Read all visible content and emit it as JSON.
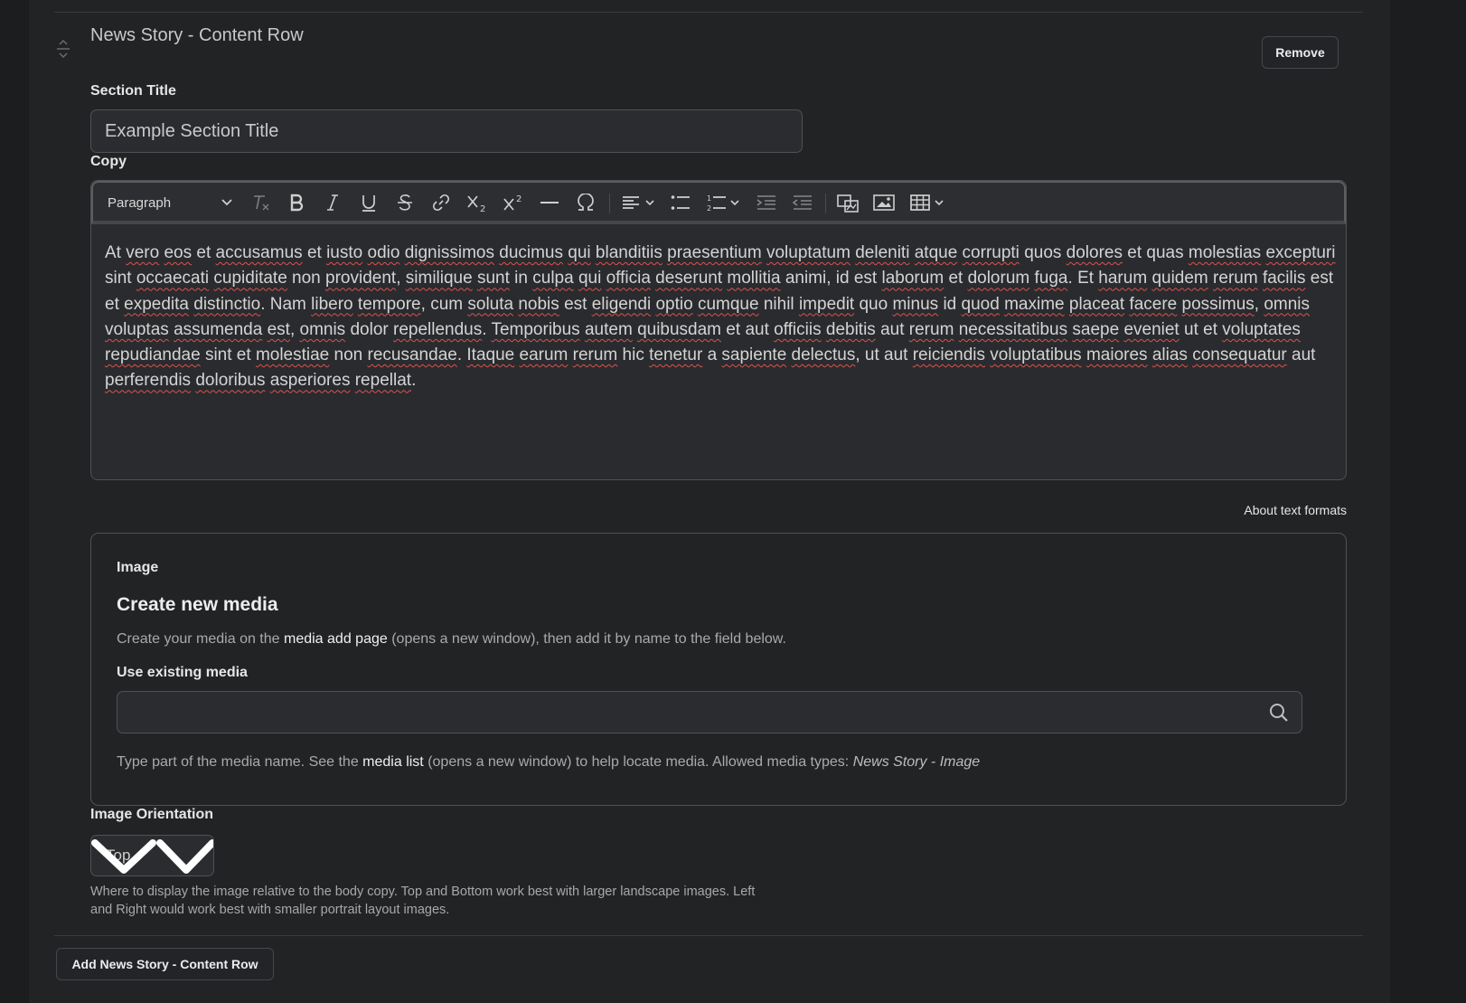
{
  "content_row": {
    "title": "News Story - Content Row",
    "remove_label": "Remove"
  },
  "section_title": {
    "label": "Section Title",
    "value": "Example Section Title"
  },
  "copy": {
    "label": "Copy",
    "toolbar": {
      "format": "Paragraph",
      "icons": [
        "remove-format-icon",
        "bold-icon",
        "italic-icon",
        "underline-icon",
        "strikethrough-icon",
        "link-icon",
        "subscript-icon",
        "superscript-icon",
        "horizontal-line-icon",
        "special-characters-icon",
        "align-icon",
        "bulleted-list-icon",
        "numbered-list-icon",
        "indent-icon",
        "outdent-icon",
        "insert-media-icon",
        "insert-image-icon",
        "insert-table-icon"
      ]
    },
    "body_text": "At vero eos et accusamus et iusto odio dignissimos ducimus qui blanditiis praesentium voluptatum deleniti atque corrupti quos dolores et quas molestias excepturi sint occaecati cupiditate non provident, similique sunt in culpa qui officia deserunt mollitia animi, id est laborum et dolorum fuga. Et harum quidem rerum facilis est et expedita distinctio. Nam libero tempore, cum soluta nobis est eligendi optio cumque nihil impedit quo minus id quod maxime placeat facere possimus, omnis voluptas assumenda est, omnis dolor repellendus. Temporibus autem quibusdam et aut officiis debitis aut rerum necessitatibus saepe eveniet ut et voluptates repudiandae sint et molestiae non recusandae. Itaque earum rerum hic tenetur a sapiente delectus, ut aut reiciendis voluptatibus maiores alias consequatur aut perferendis doloribus asperiores repellat.",
    "about_formats": "About text formats"
  },
  "image": {
    "label": "Image",
    "heading": "Create new media",
    "desc_before": "Create your media on the ",
    "desc_link": "media add page",
    "desc_after": " (opens a new window), then add it by name to the field below.",
    "existing_label": "Use existing media",
    "search_value": "",
    "help_before": "Type part of the media name. See the ",
    "help_link": "media list",
    "help_after": " (opens a new window) to help locate media. Allowed media types: ",
    "help_types": "News Story - Image"
  },
  "orientation": {
    "label": "Image Orientation",
    "value": "Top",
    "help": "Where to display the image relative to the body copy. Top and Bottom work best with larger landscape images. Left and Right would work best with smaller portrait layout images."
  },
  "add_row_label": "Add News Story - Content Row"
}
